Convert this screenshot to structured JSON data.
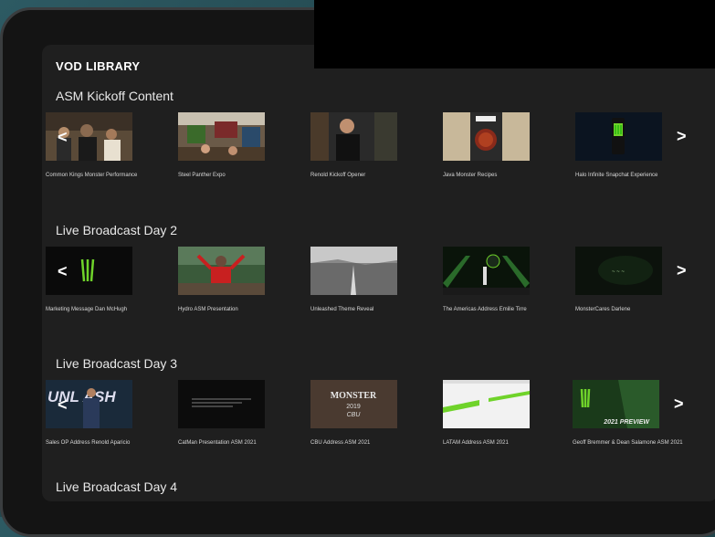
{
  "page": {
    "title": "VOD LIBRARY"
  },
  "sections": [
    {
      "title": "ASM Kickoff Content",
      "items": [
        {
          "caption": "Common Kings Monster Performance"
        },
        {
          "caption": "Steel Panther Expo"
        },
        {
          "caption": "Renold Kickoff Opener"
        },
        {
          "caption": "Java Monster Recipes"
        },
        {
          "caption": "Halo Infinite Snapchat Experience"
        }
      ],
      "nav": {
        "left": "<",
        "right": ">"
      }
    },
    {
      "title": "Live Broadcast Day 2",
      "items": [
        {
          "caption": "Marketing Message Dan McHugh"
        },
        {
          "caption": "Hydro ASM Presentation"
        },
        {
          "caption": "Unleashed Theme Reveal"
        },
        {
          "caption": "The Americas Address Emilie Tirre"
        },
        {
          "caption": "MonsterCares Darlene"
        }
      ],
      "nav": {
        "left": "<",
        "right": ">"
      }
    },
    {
      "title": "Live Broadcast Day 3",
      "items": [
        {
          "caption": "Sales OP Address Renold Aparicio"
        },
        {
          "caption": "CatMan Presentation ASM 2021"
        },
        {
          "caption": "CBU Address ASM 2021"
        },
        {
          "caption": "LATAM Address ASM 2021"
        },
        {
          "caption": "Geoff Bremmer & Dean Salamone ASM 2021"
        }
      ],
      "nav": {
        "left": "<",
        "right": ">"
      },
      "thumb_text": {
        "unleash": "UNL ASH",
        "monster": "MONSTER",
        "year": "2019",
        "cbu": "CBU",
        "preview": "2021 PREVIEW"
      }
    },
    {
      "title": "Live Broadcast Day 4"
    }
  ],
  "colors": {
    "monster_green": "#6fd32a",
    "screen_bg": "#1f1f1f"
  }
}
